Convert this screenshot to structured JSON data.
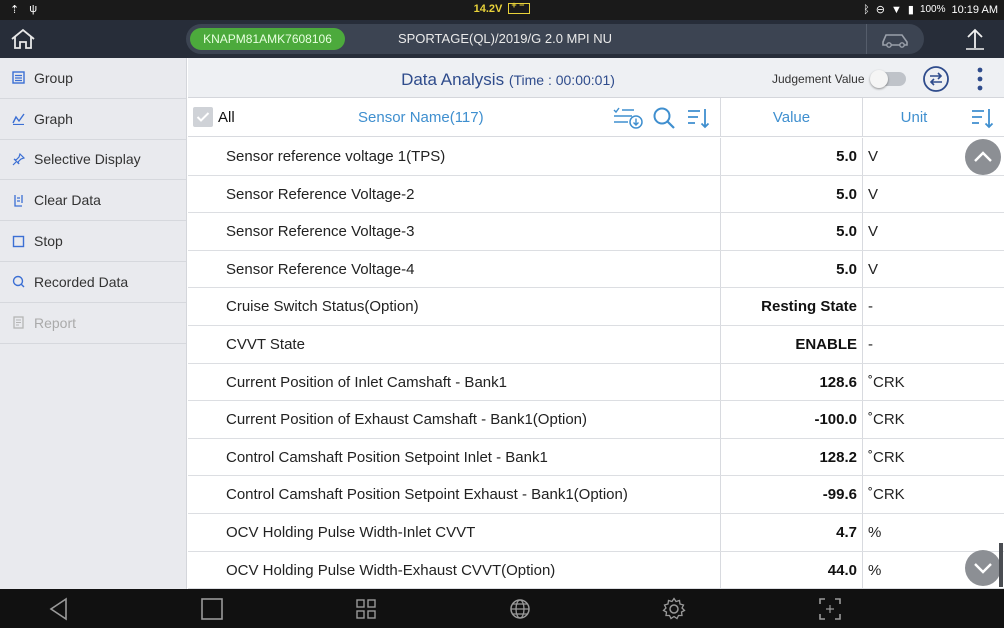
{
  "status_bar": {
    "voltage": "14.2V",
    "battery_pct": "100%",
    "clock": "10:19 AM"
  },
  "title_bar": {
    "vin": "KNAPM81AMK7608106",
    "vehicle": "SPORTAGE(QL)/2019/G 2.0 MPI NU"
  },
  "sidebar": {
    "items": [
      {
        "label": "Group",
        "icon": "group-icon",
        "enabled": true
      },
      {
        "label": "Graph",
        "icon": "graph-icon",
        "enabled": true
      },
      {
        "label": "Selective Display",
        "icon": "pin-icon",
        "enabled": true
      },
      {
        "label": "Clear Data",
        "icon": "clear-icon",
        "enabled": true
      },
      {
        "label": "Stop",
        "icon": "stop-icon",
        "enabled": true
      },
      {
        "label": "Recorded Data",
        "icon": "recorded-icon",
        "enabled": true
      },
      {
        "label": "Report",
        "icon": "report-icon",
        "enabled": false
      }
    ]
  },
  "header": {
    "title": "Data Analysis",
    "time": "(Time : 00:00:01)",
    "judgement_label": "Judgement Value",
    "judgement_on": false
  },
  "columns": {
    "all": "All",
    "sensor": "Sensor Name(117)",
    "value": "Value",
    "unit": "Unit"
  },
  "rows": [
    {
      "name": "Sensor reference voltage 1(TPS)",
      "value": "5.0",
      "unit": "V"
    },
    {
      "name": "Sensor Reference Voltage-2",
      "value": "5.0",
      "unit": "V"
    },
    {
      "name": "Sensor Reference Voltage-3",
      "value": "5.0",
      "unit": "V"
    },
    {
      "name": "Sensor Reference Voltage-4",
      "value": "5.0",
      "unit": "V"
    },
    {
      "name": "Cruise Switch Status(Option)",
      "value": "Resting State",
      "unit": "-"
    },
    {
      "name": "CVVT State",
      "value": "ENABLE",
      "unit": "-"
    },
    {
      "name": "Current Position of Inlet Camshaft - Bank1",
      "value": "128.6",
      "unit": "˚CRK"
    },
    {
      "name": "Current Position of Exhaust Camshaft - Bank1(Option)",
      "value": "-100.0",
      "unit": "˚CRK"
    },
    {
      "name": "Control Camshaft Position Setpoint Inlet - Bank1",
      "value": "128.2",
      "unit": "˚CRK"
    },
    {
      "name": "Control Camshaft Position Setpoint Exhaust - Bank1(Option)",
      "value": "-99.6",
      "unit": "˚CRK"
    },
    {
      "name": "OCV Holding Pulse Width-Inlet CVVT",
      "value": "4.7",
      "unit": "%"
    },
    {
      "name": "OCV Holding Pulse Width-Exhaust CVVT(Option)",
      "value": "44.0",
      "unit": "%"
    }
  ],
  "colors": {
    "accent_blue": "#3f8fcf",
    "title_blue": "#2f4c8c",
    "vin_green": "#4caa3c",
    "titlebar_bg": "#272d39"
  }
}
